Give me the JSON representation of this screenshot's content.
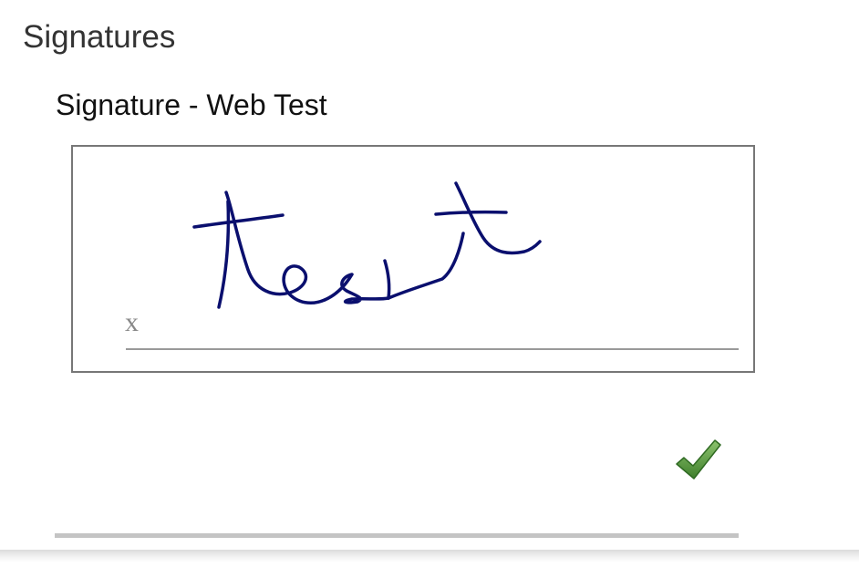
{
  "page": {
    "title": "Signatures"
  },
  "signature": {
    "title": "Signature - Web Test",
    "x_mark": "x",
    "ink_text": "test",
    "ink_color": "#0a0f6e"
  },
  "actions": {
    "accept_icon": "checkmark-icon",
    "accept_color": "#4a8f3a"
  }
}
